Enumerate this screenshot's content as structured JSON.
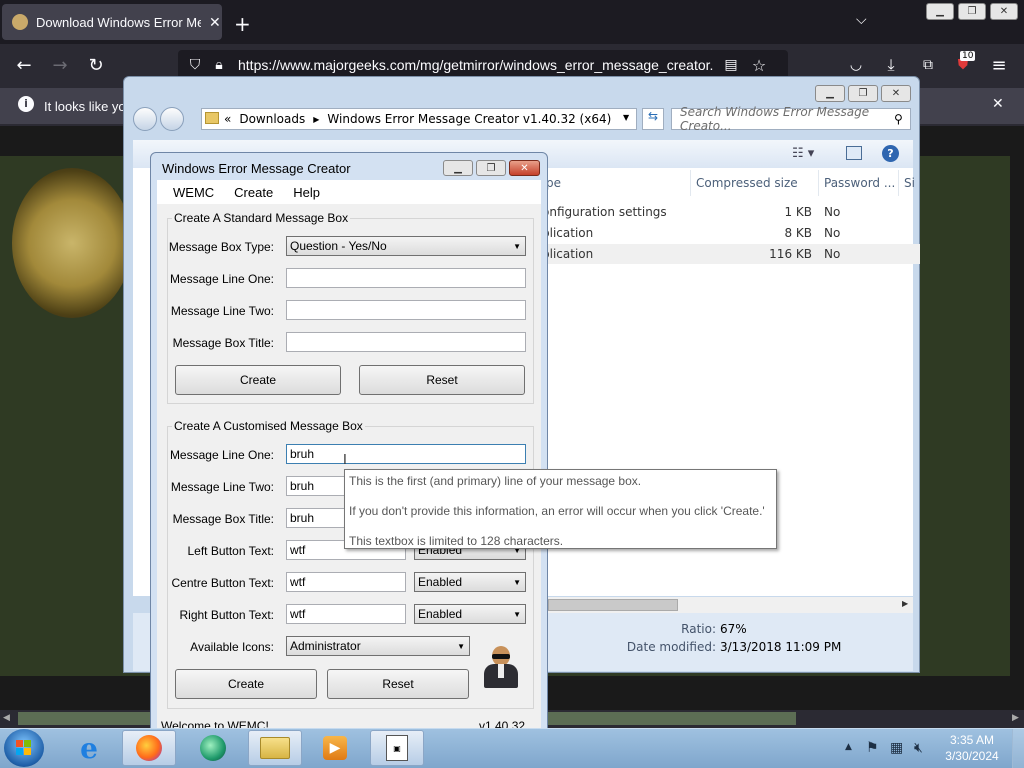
{
  "browser": {
    "tab_title": "Download Windows Error Messa",
    "new_tab": "+",
    "url": "https://www.majorgeeks.com/mg/getmirror/windows_error_message_creator.",
    "notification": "It looks like you",
    "extension_badge": "10"
  },
  "explorer": {
    "breadcrumb_prefix": "«",
    "breadcrumb": [
      "Downloads",
      "Windows Error Message Creator v1.40.32 (x64)"
    ],
    "search_placeholder": "Search Windows Error Message Creato...",
    "columns": [
      "pe",
      "Compressed size",
      "Password ...",
      "Si"
    ],
    "rows": [
      {
        "type": "onfiguration settings",
        "size": "1 KB",
        "pw": "No"
      },
      {
        "type": "plication",
        "size": "8 KB",
        "pw": "No"
      },
      {
        "type": "plication",
        "size": "116 KB",
        "pw": "No"
      }
    ],
    "details": {
      "ratio_label": "Ratio:",
      "ratio": "67%",
      "date_label": "Date modified:",
      "date": "3/13/2018 11:09 PM"
    }
  },
  "wemc": {
    "title": "Windows Error Message Creator",
    "menu": [
      "WEMC",
      "Create",
      "Help"
    ],
    "standard": {
      "heading": "Create A Standard Message Box",
      "type_label": "Message Box Type:",
      "type_value": "Question - Yes/No",
      "line1_label": "Message Line One:",
      "line1": "",
      "line2_label": "Message Line Two:",
      "line2": "",
      "title_label": "Message Box Title:",
      "title": "",
      "create": "Create",
      "reset": "Reset"
    },
    "custom": {
      "heading": "Create A Customised Message Box",
      "line1_label": "Message Line One:",
      "line1": "bruh",
      "line2_label": "Message Line Two:",
      "line2": "bruh",
      "title_label": "Message Box Title:",
      "title": "bruh",
      "left_label": "Left Button Text:",
      "left": "wtf",
      "left_state": "Enabled",
      "centre_label": "Centre Button Text:",
      "centre": "wtf",
      "centre_state": "Enabled",
      "right_label": "Right Button Text:",
      "right": "wtf",
      "right_state": "Enabled",
      "icons_label": "Available Icons:",
      "icon_value": "Administrator",
      "create": "Create",
      "reset": "Reset"
    },
    "status_left": "Welcome to WEMC!",
    "status_right": "v1.40.32"
  },
  "tooltip": {
    "line1": "This is the first (and primary) line of your message box.",
    "line2": "If you don't provide this information, an error will occur when you click 'Create.'",
    "line3": "This textbox is limited to 128 characters."
  },
  "clock": {
    "time": "3:35 AM",
    "date": "3/30/2024"
  }
}
